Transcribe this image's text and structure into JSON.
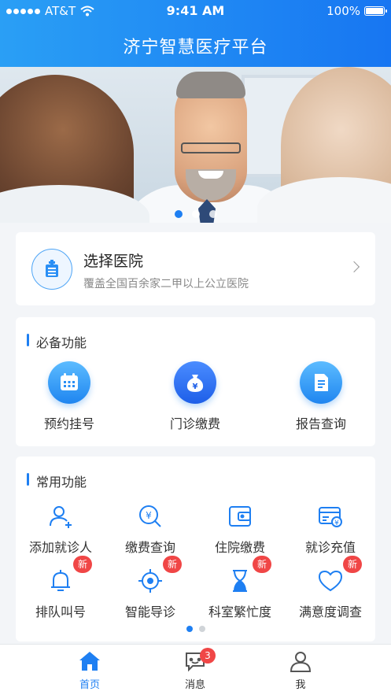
{
  "status_bar": {
    "carrier": "AT&T",
    "time": "9:41 AM",
    "battery": "100%"
  },
  "header": {
    "title": "济宁智慧医疗平台"
  },
  "banner": {
    "slide_count": 3,
    "active_slide": 1
  },
  "hospital_select": {
    "title": "选择医院",
    "subtitle": "覆盖全国百余家二甲以上公立医院"
  },
  "essential": {
    "title": "必备功能",
    "items": [
      {
        "label": "预约挂号",
        "icon": "calendar-icon"
      },
      {
        "label": "门诊缴费",
        "icon": "money-bag-icon"
      },
      {
        "label": "报告查询",
        "icon": "report-icon"
      }
    ]
  },
  "common": {
    "title": "常用功能",
    "items": [
      {
        "label": "添加就诊人",
        "icon": "add-user-icon",
        "badge": ""
      },
      {
        "label": "缴费查询",
        "icon": "payment-search-icon",
        "badge": ""
      },
      {
        "label": "住院缴费",
        "icon": "wallet-icon",
        "badge": ""
      },
      {
        "label": "就诊充值",
        "icon": "card-recharge-icon",
        "badge": ""
      },
      {
        "label": "排队叫号",
        "icon": "bell-icon",
        "badge": "新"
      },
      {
        "label": "智能导诊",
        "icon": "target-icon",
        "badge": "新"
      },
      {
        "label": "科室繁忙度",
        "icon": "hourglass-icon",
        "badge": "新"
      },
      {
        "label": "满意度调查",
        "icon": "heart-icon",
        "badge": "新"
      }
    ],
    "page_count": 2,
    "active_page": 1
  },
  "tabbar": {
    "items": [
      {
        "label": "首页",
        "icon": "home-icon",
        "active": true
      },
      {
        "label": "消息",
        "icon": "message-icon",
        "badge": "3"
      },
      {
        "label": "我",
        "icon": "user-icon"
      }
    ]
  },
  "colors": {
    "primary": "#1e7ff2",
    "header_start": "#2a9ff5",
    "header_end": "#1776f2",
    "badge": "#f04646"
  }
}
